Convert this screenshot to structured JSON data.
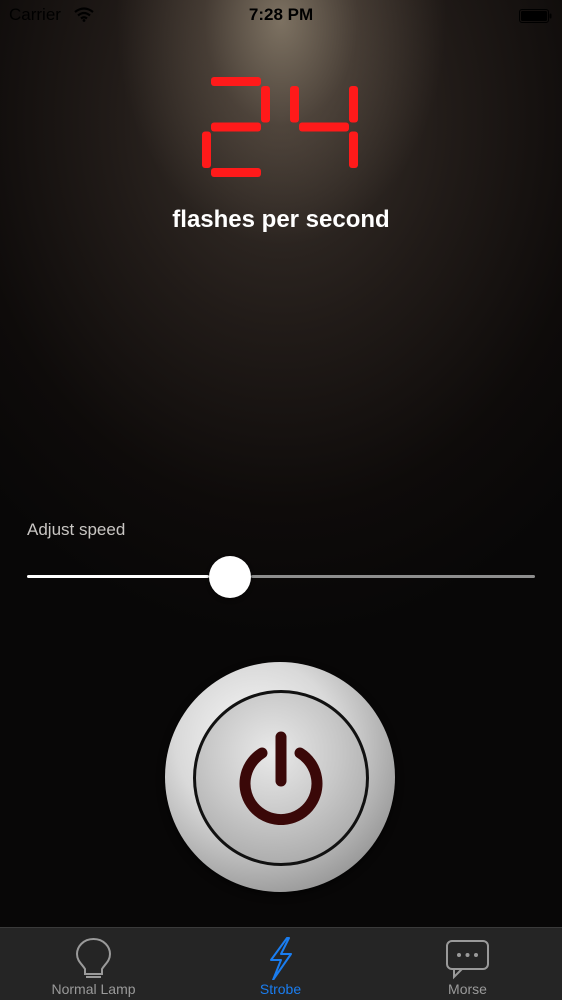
{
  "status_bar": {
    "carrier": "Carrier",
    "time": "7:28 PM",
    "wifi_icon": "wifi-icon",
    "battery_icon": "battery-icon"
  },
  "display": {
    "value": "24",
    "unit_label": "flashes per second",
    "digit_color": "#ff1a1a"
  },
  "speed": {
    "label": "Adjust speed",
    "value_fraction": 0.4
  },
  "power": {
    "icon": "power-icon",
    "icon_color": "#3a0808"
  },
  "tabs": [
    {
      "label": "Normal Lamp",
      "icon": "lightbulb-icon",
      "active": false
    },
    {
      "label": "Strobe",
      "icon": "lightning-bolt-icon",
      "active": true
    },
    {
      "label": "Morse",
      "icon": "speech-bubble-icon",
      "active": false
    }
  ],
  "colors": {
    "accent": "#1a7df0",
    "tab_inactive": "#9a9a9a"
  }
}
